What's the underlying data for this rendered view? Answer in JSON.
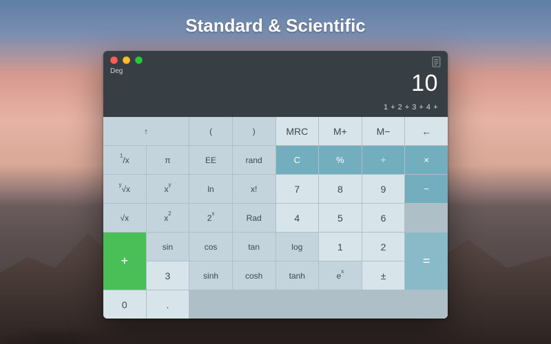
{
  "headline": "Standard & Scientific",
  "window": {
    "mode": "Deg",
    "result": "10",
    "expression": "1 + 2 + 3 + 4 +"
  },
  "keys": {
    "row0": {
      "up": "↑",
      "lparen": "(",
      "rparen": ")",
      "mrc": "MRC",
      "mplus": "M+",
      "mminus": "M−",
      "back": "←"
    },
    "row1": {
      "recip": "1/x",
      "pi": "π",
      "ee": "EE",
      "rand": "rand",
      "clear": "C",
      "percent": "%",
      "divide": "÷",
      "multiply": "×"
    },
    "row2": {
      "yroot": "y√x",
      "xy": "xy",
      "ln": "ln",
      "fact": "x!",
      "k7": "7",
      "k8": "8",
      "k9": "9",
      "minus": "−"
    },
    "row3": {
      "sqrt": "√x",
      "x2": "x2",
      "p2x": "2x",
      "rad": "Rad",
      "k4": "4",
      "k5": "5",
      "k6": "6",
      "plus": "+"
    },
    "row4": {
      "sin": "sin",
      "cos": "cos",
      "tan": "tan",
      "log": "log",
      "k1": "1",
      "k2": "2",
      "k3": "3",
      "equals": "="
    },
    "row5": {
      "sinh": "sinh",
      "cosh": "cosh",
      "tanh": "tanh",
      "ex": "ex",
      "pm": "±",
      "k0": "0",
      "dot": "."
    }
  }
}
